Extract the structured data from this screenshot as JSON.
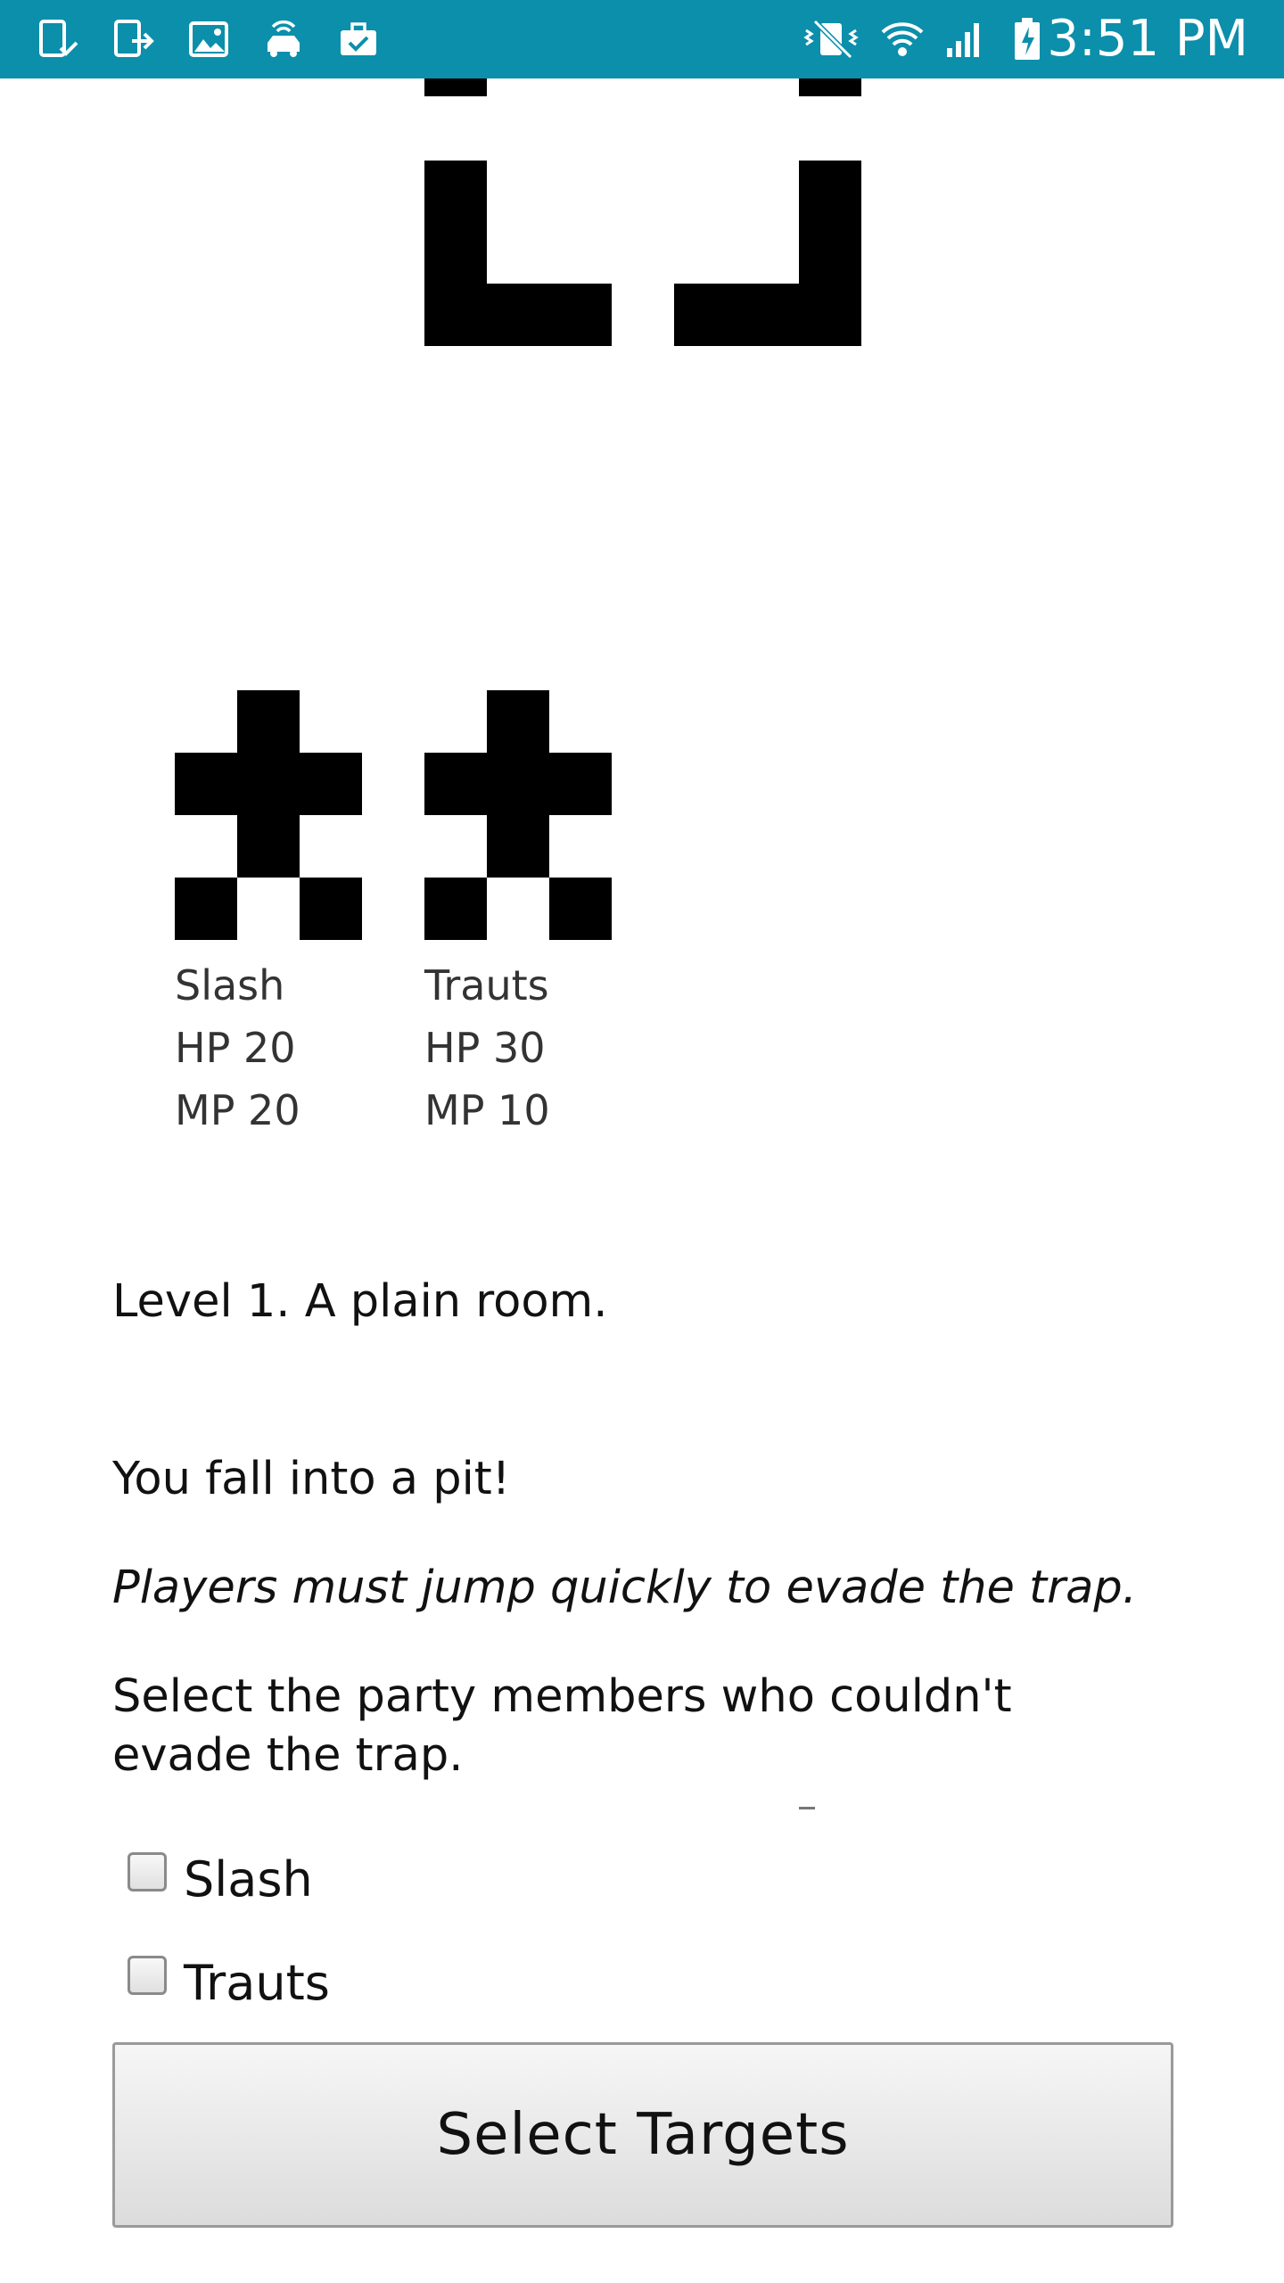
{
  "status_bar": {
    "time": "3:51 PM",
    "left_icons": [
      "tablet-check-icon",
      "tablet-exit-icon",
      "image-icon",
      "car-wifi-icon",
      "briefcase-check-icon"
    ],
    "right_icons": [
      "vibrate-icon",
      "wifi-icon",
      "cell-signal-icon",
      "battery-charging-icon"
    ],
    "color": "#0b8fab"
  },
  "party": [
    {
      "name": "Slash",
      "hp": "HP 20",
      "mp": "MP 20"
    },
    {
      "name": "Trauts",
      "hp": "HP 30",
      "mp": "MP 10"
    }
  ],
  "narrative": {
    "level": "Level 1. A plain room.",
    "event": "You fall into a pit!",
    "hint": "Players must jump quickly to evade the trap.",
    "prompt": "Select the party members who couldn't evade the trap."
  },
  "choices": [
    {
      "label": "Slash",
      "checked": false
    },
    {
      "label": "Trauts",
      "checked": false
    }
  ],
  "action_button": {
    "label": "Select Targets"
  }
}
